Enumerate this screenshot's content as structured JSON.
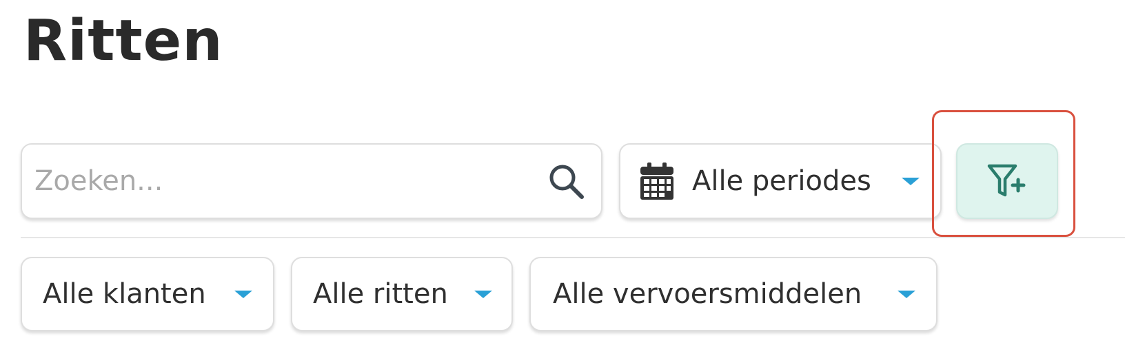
{
  "page": {
    "title": "Ritten"
  },
  "search": {
    "placeholder": "Zoeken...",
    "icon": "search-icon"
  },
  "period_dropdown": {
    "label": "Alle periodes",
    "icon": "calendar-icon"
  },
  "add_filter_button": {
    "icon": "filter-plus-icon",
    "color": "#2a7d6c",
    "background": "#dff4ee"
  },
  "filters": [
    {
      "label": "Alle klanten"
    },
    {
      "label": "Alle ritten"
    },
    {
      "label": "Alle vervoersmiddelen"
    }
  ],
  "colors": {
    "accent_caret": "#2aa0d6",
    "highlight_outline": "#d9503e"
  }
}
